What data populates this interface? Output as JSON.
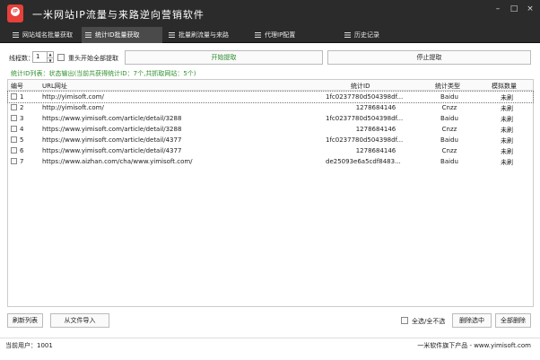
{
  "app": {
    "title": "一米网站IP流量与来路逆向营销软件",
    "logo_text": "IP"
  },
  "window_controls": {
    "minimize": "–",
    "maximize": "□",
    "close": "×"
  },
  "tabs": [
    {
      "label": "网站域名批量获取",
      "active": false
    },
    {
      "label": "统计ID批量获取",
      "active": true
    },
    {
      "label": "批量刷流量与来路",
      "active": false
    },
    {
      "label": "代理IP配置",
      "active": false
    },
    {
      "label": "历史记录",
      "active": false
    }
  ],
  "toolbar": {
    "threads_label": "线程数：",
    "threads_value": "1",
    "restart_all_label": "重头开始全部提取",
    "start_button": "开始提取",
    "stop_button": "停止提取"
  },
  "status_line": "统计ID列表：状态输出(当前共获得统计ID：7个,共抓取网站：5个)",
  "table": {
    "headers": [
      "编号",
      "URL网址",
      "统计ID",
      "统计类型",
      "模拟数量"
    ],
    "rows": [
      {
        "no": "1",
        "url": "http://yimisoft.com/",
        "id": "1fc0237780d504398df...",
        "type": "Baidu",
        "count": "未刷"
      },
      {
        "no": "2",
        "url": "http://yimisoft.com/",
        "id": "1278684146",
        "type": "Cnzz",
        "count": "未刷"
      },
      {
        "no": "3",
        "url": "https://www.yimisoft.com/article/detail/3288",
        "id": "1fc0237780d504398df...",
        "type": "Baidu",
        "count": "未刷"
      },
      {
        "no": "4",
        "url": "https://www.yimisoft.com/article/detail/3288",
        "id": "1278684146",
        "type": "Cnzz",
        "count": "未刷"
      },
      {
        "no": "5",
        "url": "https://www.yimisoft.com/article/detail/4377",
        "id": "1fc0237780d504398df...",
        "type": "Baidu",
        "count": "未刷"
      },
      {
        "no": "6",
        "url": "https://www.yimisoft.com/article/detail/4377",
        "id": "1278684146",
        "type": "Cnzz",
        "count": "未刷"
      },
      {
        "no": "7",
        "url": "https://www.aizhan.com/cha/www.yimisoft.com/",
        "id": "de25093e6a5cdf8483...",
        "type": "Baidu",
        "count": "未刷"
      }
    ]
  },
  "bottom": {
    "refresh_button": "刷新列表",
    "import_button": "从文件导入",
    "select_all_label": "全选/全不选",
    "delete_selected_button": "删除选中",
    "delete_all_button": "全部删除"
  },
  "statusbar": {
    "current_user": "当前用户：1001",
    "brand": "一米软件旗下产品 - www.yimisoft.com"
  }
}
